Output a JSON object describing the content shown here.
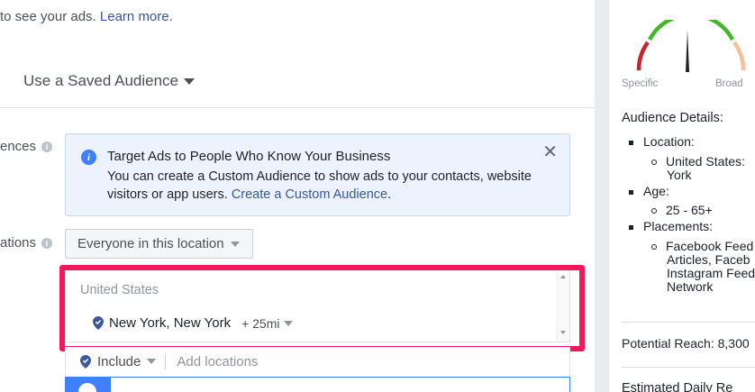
{
  "main": {
    "intro": {
      "text": "to see your ads. ",
      "link": "Learn more."
    },
    "saved_audience": {
      "label": "Use a Saved Audience"
    },
    "custom_audiences_label": "ences",
    "notice": {
      "title": "Target Ads to People Who Know Your Business",
      "body": "You can create a Custom Audience to show ads to your contacts, website visitors or app users. ",
      "link": "Create a Custom Audience",
      "link_suffix": "."
    },
    "locations_label": "ations",
    "location_type": {
      "selected": "Everyone in this location"
    },
    "location_box": {
      "country": "United States",
      "item": {
        "name": "New York, New York",
        "radius": "+ 25mi"
      }
    },
    "include": {
      "label": "Include",
      "placeholder": "Add locations"
    }
  },
  "side": {
    "gauge": {
      "left_label": "Specific",
      "right_label": "Broad",
      "colors": {
        "low": "#c8252c",
        "mid": "#42b72a",
        "high": "#f7c09b",
        "needle": "#1d2129"
      }
    },
    "details_title": "Audience Details:",
    "location_label": "Location:",
    "location_value_1": "United States:",
    "location_value_2": "York",
    "age_label": "Age:",
    "age_value": "25 - 65+",
    "placements_label": "Placements:",
    "placements_lines": [
      "Facebook Feed",
      "Articles, Faceb",
      "Instagram Feed",
      "Network"
    ],
    "potential_reach": "Potential Reach: 8,300",
    "estimated_daily": "Estimated Daily Re"
  },
  "colors": {
    "highlight": "#f2185b",
    "link": "#365899",
    "notice_bg": "#ecf3ff",
    "accent": "#4080ff"
  }
}
